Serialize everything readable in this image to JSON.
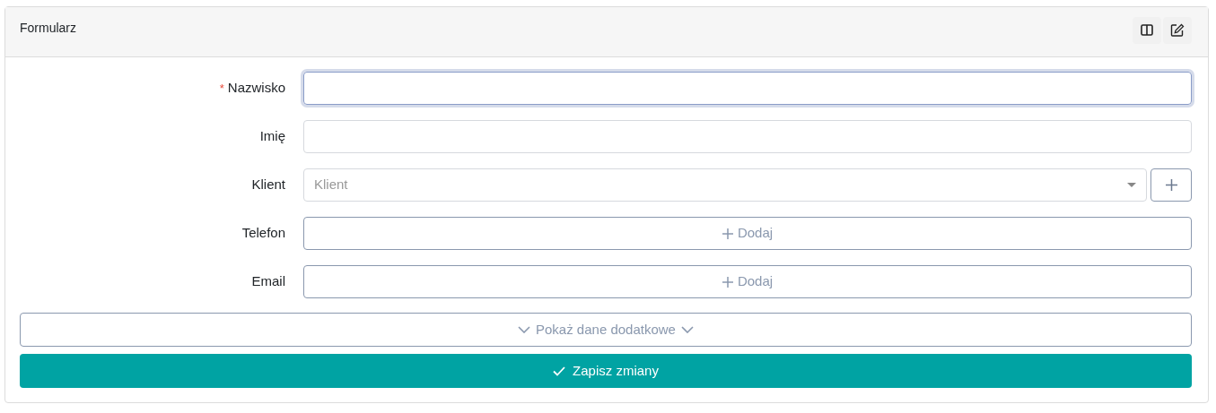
{
  "panel": {
    "title": "Formularz"
  },
  "fields": [
    {
      "kind": "text",
      "label": "Nazwisko",
      "required_mark": "*",
      "focused": true
    },
    {
      "kind": "text",
      "label": "Imię",
      "focused": false
    },
    {
      "kind": "select",
      "label": "Klient",
      "placeholder": "Klient",
      "add_button": true
    },
    {
      "kind": "add",
      "label": "Telefon",
      "button": "Dodaj"
    },
    {
      "kind": "add",
      "label": "Email",
      "button": "Dodaj"
    }
  ],
  "more_button": "Pokaż dane dodatkowe",
  "save_button": "Zapisz zmiany"
}
